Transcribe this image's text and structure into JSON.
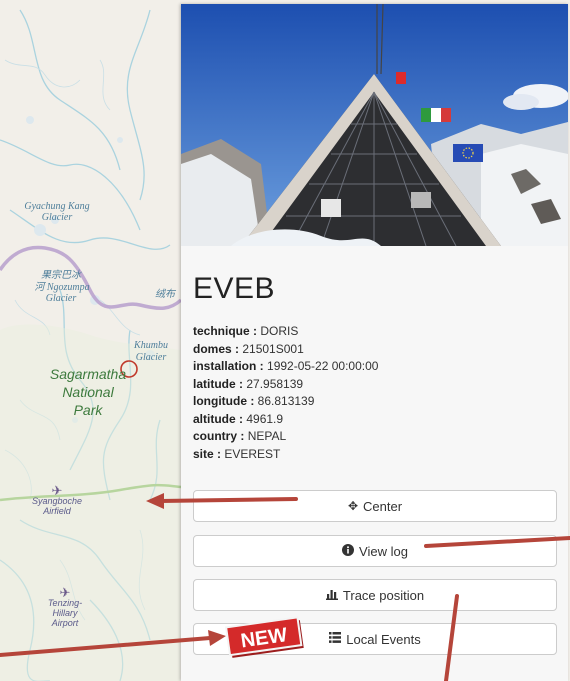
{
  "map": {
    "labels": {
      "glacier_gyachung": "Gyachung Kang Glacier",
      "chinese_label": "果宗巴冰",
      "glacier_ngozumpa_a": "河 Ngozumpa",
      "glacier_ngozumpa_b": "Glacier",
      "chinese_label_2": "绒布",
      "glacier_khumbu_a": "Khumbu",
      "glacier_khumbu_b": "Glacier",
      "park_a": "Sagarmatha",
      "park_b": "National",
      "park_c": "Park",
      "airfield_a": "Syangboche",
      "airfield_b": "Airfield",
      "airport_a": "Tenzing-",
      "airport_b": "Hillary",
      "airport_c": "Airport"
    },
    "colors": {
      "land": "#f2efe9",
      "water": "#aad3df",
      "border": "#a88fbf",
      "park_text": "#3d7a3d"
    }
  },
  "station": {
    "name": "EVEB",
    "properties": [
      {
        "key": "technique",
        "value": "DORIS"
      },
      {
        "key": "domes",
        "value": "21501S001"
      },
      {
        "key": "installation",
        "value": "1992-05-22 00:00:00"
      },
      {
        "key": "latitude",
        "value": "27.958139"
      },
      {
        "key": "longitude",
        "value": "86.813139"
      },
      {
        "key": "altitude",
        "value": "4961.9"
      },
      {
        "key": "country",
        "value": "NEPAL"
      },
      {
        "key": "site",
        "value": "EVEREST"
      }
    ]
  },
  "buttons": {
    "center": {
      "label": "Center",
      "icon": "move-arrows-icon"
    },
    "view_log": {
      "label": "View log",
      "icon": "info-circle-icon"
    },
    "trace_position": {
      "label": "Trace position",
      "icon": "bar-chart-icon"
    },
    "local_events": {
      "label": "Local Events",
      "icon": "list-icon"
    }
  },
  "badge": {
    "label": "NEW",
    "color": "#d42a2a"
  },
  "annotation_color": "#b5453a"
}
